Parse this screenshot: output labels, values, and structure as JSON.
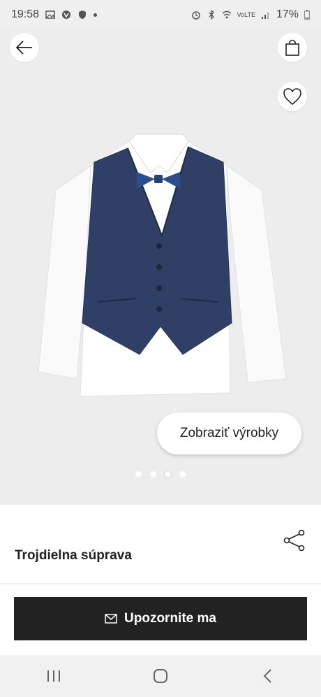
{
  "status_bar": {
    "time": "19:58",
    "battery": "17%",
    "network": "VoLTE"
  },
  "product": {
    "name": "Trojdielna súprava",
    "show_products_label": "Zobraziť výrobky",
    "image_count": 4,
    "active_image_index": 2
  },
  "actions": {
    "notify_label": "Upozornite ma"
  },
  "colors": {
    "primary_button": "#222222",
    "background": "#ededed"
  }
}
